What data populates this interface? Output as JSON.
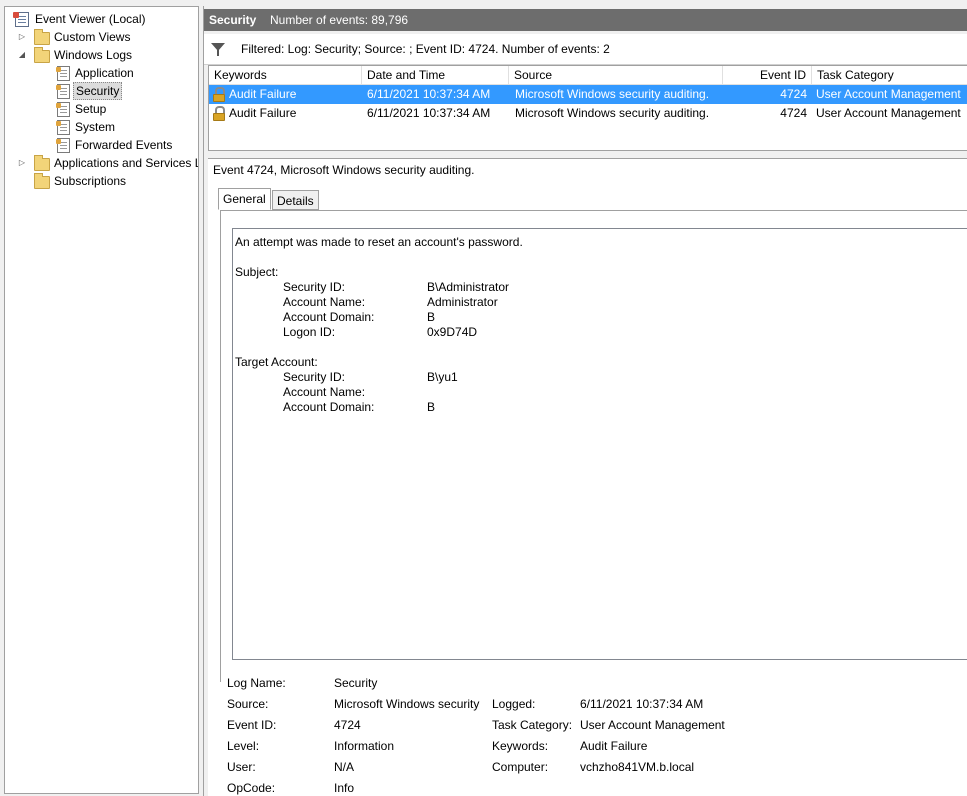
{
  "tree": {
    "root": "Event Viewer (Local)",
    "custom_views": "Custom Views",
    "windows_logs": "Windows Logs",
    "logs": [
      "Application",
      "Security",
      "Setup",
      "System",
      "Forwarded Events"
    ],
    "apps_services": "Applications and Services L",
    "subscriptions": "Subscriptions"
  },
  "header": {
    "title": "Security",
    "count": "Number of events: 89,796"
  },
  "filter": {
    "text": "Filtered: Log: Security; Source: ; Event ID: 4724. Number of events: 2"
  },
  "grid": {
    "columns": [
      "Keywords",
      "Date and Time",
      "Source",
      "Event ID",
      "Task Category"
    ],
    "rows": [
      {
        "keywords": "Audit Failure",
        "date": "6/11/2021 10:37:34 AM",
        "source": "Microsoft Windows security auditing.",
        "event_id": "4724",
        "task": "User Account Management"
      },
      {
        "keywords": "Audit Failure",
        "date": "6/11/2021 10:37:34 AM",
        "source": "Microsoft Windows security auditing.",
        "event_id": "4724",
        "task": "User Account Management"
      }
    ]
  },
  "detail": {
    "header": "Event 4724, Microsoft Windows security auditing.",
    "tabs": [
      "General",
      "Details"
    ],
    "description": {
      "intro": "An attempt was made to reset an account's password.",
      "subject_label": "Subject:",
      "subject": [
        {
          "k": "Security ID:",
          "v": "B\\Administrator"
        },
        {
          "k": "Account Name:",
          "v": "Administrator"
        },
        {
          "k": "Account Domain:",
          "v": "B"
        },
        {
          "k": "Logon ID:",
          "v": "0x9D74D"
        }
      ],
      "target_label": "Target Account:",
      "target": [
        {
          "k": "Security ID:",
          "v": "B\\yu1"
        },
        {
          "k": "Account Name:",
          "v": ""
        },
        {
          "k": "Account Domain:",
          "v": "B"
        }
      ]
    },
    "props": {
      "log_name_label": "Log Name:",
      "log_name": "Security",
      "source_label": "Source:",
      "source": "Microsoft Windows security",
      "logged_label": "Logged:",
      "logged": "6/11/2021 10:37:34 AM",
      "event_id_label": "Event ID:",
      "event_id": "4724",
      "task_label": "Task Category:",
      "task": "User Account Management",
      "level_label": "Level:",
      "level": "Information",
      "keywords_label": "Keywords:",
      "keywords": "Audit Failure",
      "user_label": "User:",
      "user": "N/A",
      "computer_label": "Computer:",
      "computer": "vchzho841VM.b.local",
      "opcode_label": "OpCode:",
      "opcode": "Info"
    }
  },
  "colors": {
    "selection": "#3399ff",
    "title_bar": "#6d6d6d"
  }
}
